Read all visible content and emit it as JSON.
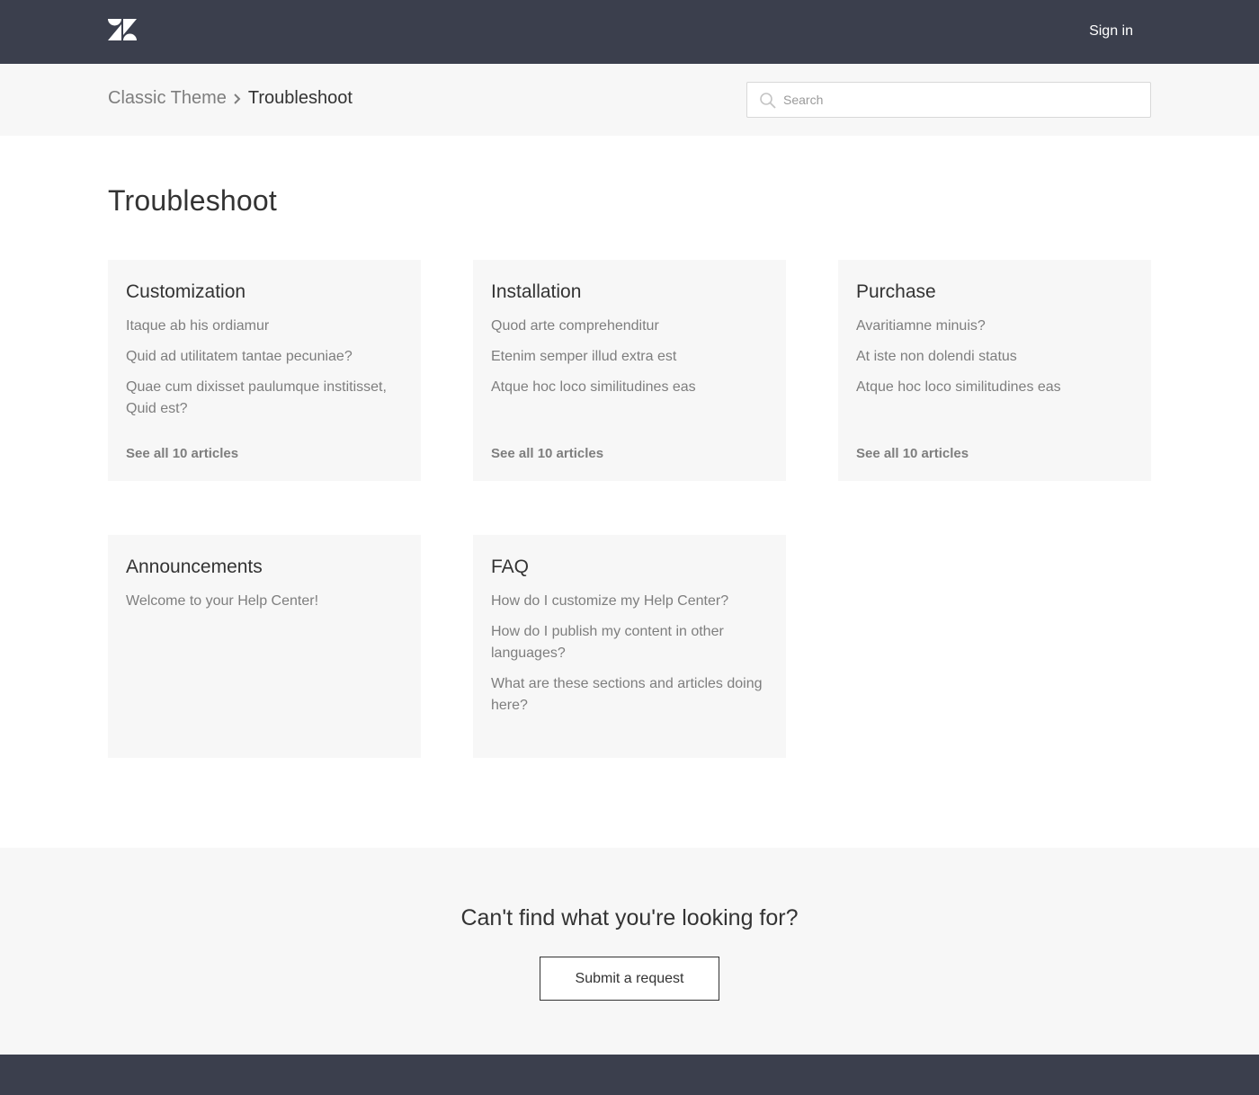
{
  "header": {
    "logo_icon": "zendesk-logo",
    "sign_in_label": "Sign in",
    "background": "#3b3f4d"
  },
  "breadcrumb": {
    "items": [
      "Classic Theme",
      "Troubleshoot"
    ],
    "separator_icon": "chevron-right-icon"
  },
  "search": {
    "placeholder": "Search",
    "icon": "search-icon"
  },
  "page": {
    "title": "Troubleshoot"
  },
  "sections": [
    {
      "title": "Customization",
      "articles": [
        "Itaque ab his ordiamur",
        "Quid ad utilitatem tantae pecuniae?",
        "Quae cum dixisset paulumque institisset, Quid est?"
      ],
      "see_all": "See all 10 articles"
    },
    {
      "title": "Installation",
      "articles": [
        "Quod arte comprehenditur",
        "Etenim semper illud extra est",
        "Atque hoc loco similitudines eas"
      ],
      "see_all": "See all 10 articles"
    },
    {
      "title": "Purchase",
      "articles": [
        "Avaritiamne minuis?",
        "At iste non dolendi status",
        "Atque hoc loco similitudines eas"
      ],
      "see_all": "See all 10 articles"
    },
    {
      "title": "Announcements",
      "articles": [
        "Welcome to your Help Center!"
      ]
    },
    {
      "title": "FAQ",
      "articles": [
        "How do I customize my Help Center?",
        "How do I publish my content in other languages?",
        "What are these sections and articles doing here?"
      ]
    }
  ],
  "cta": {
    "title": "Can't find what you're looking for?",
    "button_label": "Submit a request"
  }
}
